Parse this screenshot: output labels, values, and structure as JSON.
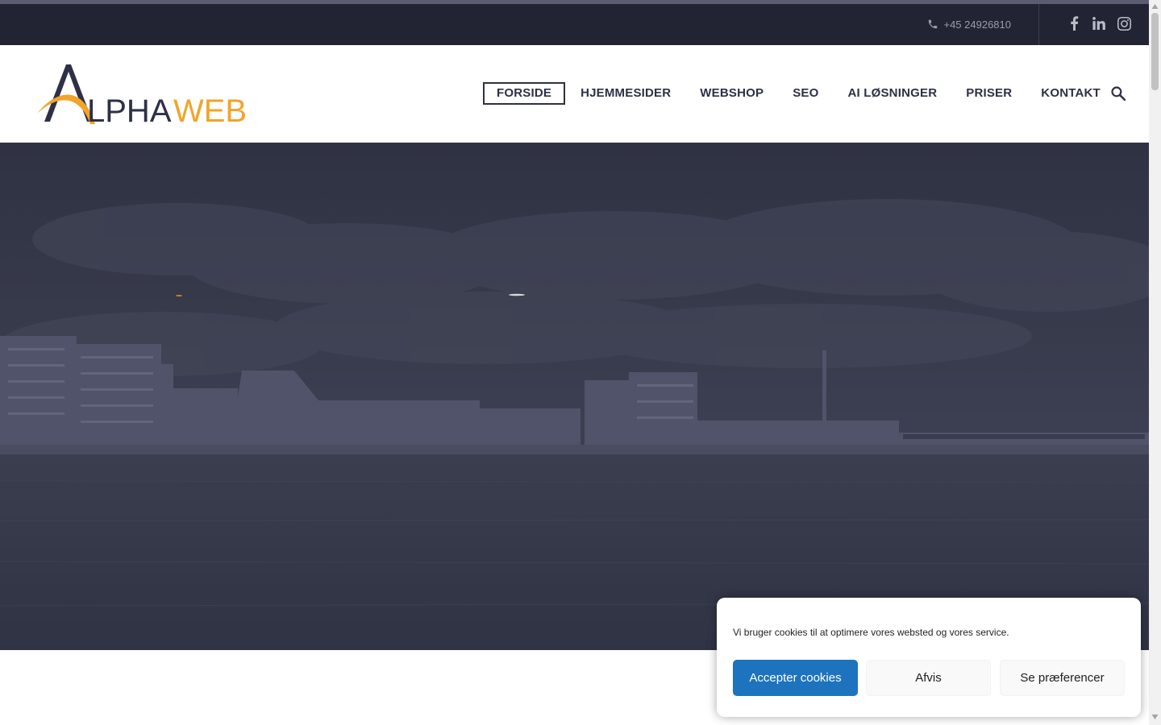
{
  "topbar": {
    "phone": "+45 24926810",
    "social_icons": [
      "facebook-icon",
      "linkedin-icon",
      "instagram-icon"
    ]
  },
  "logo": {
    "part1": "LPHA",
    "part2": "WEB",
    "letter_a": "A",
    "colors": {
      "dark": "#2e3046",
      "accent": "#f2a42a"
    }
  },
  "nav": {
    "items": [
      {
        "label": "FORSIDE",
        "active": true
      },
      {
        "label": "HJEMMESIDER"
      },
      {
        "label": "WEBSHOP"
      },
      {
        "label": "SEO"
      },
      {
        "label": "AI LØSNINGER"
      },
      {
        "label": "PRISER"
      },
      {
        "label": "KONTAKT"
      }
    ],
    "search_icon": "search-icon"
  },
  "cookie": {
    "text": "Vi bruger cookies til at optimere vores websted og vores service.",
    "accept": "Accepter cookies",
    "deny": "Afvis",
    "prefs": "Se præferencer",
    "accent": "#1e73be"
  },
  "colors": {
    "topbar": "#222433",
    "hero_overlay": "#353849"
  }
}
